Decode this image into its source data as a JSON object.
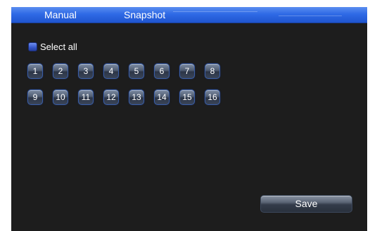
{
  "tabs": [
    {
      "label": "Manual"
    },
    {
      "label": "Snapshot"
    }
  ],
  "select_all": {
    "label": "Select all",
    "checked": true
  },
  "channels": {
    "row1": [
      "1",
      "2",
      "3",
      "4",
      "5",
      "6",
      "7",
      "8"
    ],
    "row2": [
      "9",
      "10",
      "11",
      "12",
      "13",
      "14",
      "15",
      "16"
    ]
  },
  "actions": {
    "save_label": "Save"
  },
  "colors": {
    "tab_bar": "#2f6ae6",
    "panel_background": "#1d1d1d",
    "checkbox_fill": "#3556c9"
  }
}
